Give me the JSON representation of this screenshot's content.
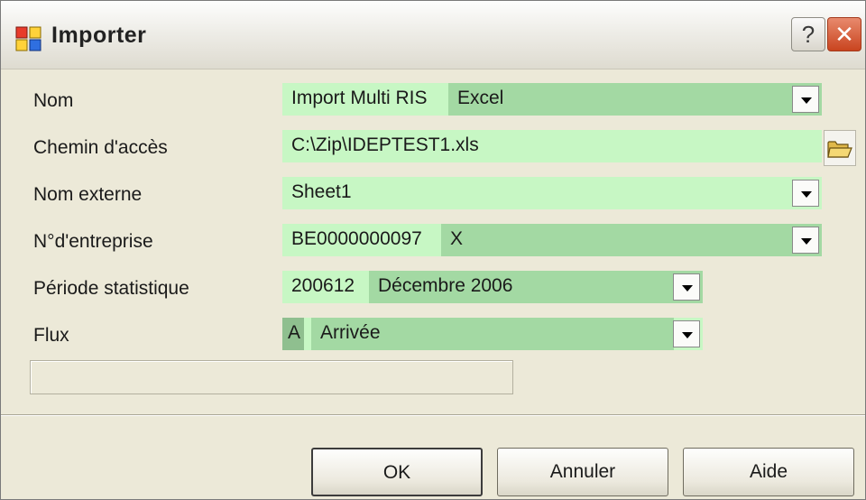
{
  "window": {
    "title": "Importer",
    "help_label": "?",
    "close_label": "✕"
  },
  "fields": {
    "nom": {
      "label": "Nom",
      "code": "Import Multi RIS",
      "value": "Excel"
    },
    "chemin": {
      "label": "Chemin d'accès",
      "value": "C:\\Zip\\IDEPTEST1.xls"
    },
    "nom_externe": {
      "label": "Nom externe",
      "value": "Sheet1"
    },
    "entreprise": {
      "label": "N°d'entreprise",
      "code": "BE0000000097",
      "value": "X"
    },
    "periode": {
      "label": "Période statistique",
      "code": "200612",
      "value": "Décembre 2006"
    },
    "flux": {
      "label": "Flux",
      "code": "A",
      "value": "Arrivée"
    }
  },
  "buttons": {
    "ok": "OK",
    "cancel": "Annuler",
    "help": "Aide"
  },
  "icons": {
    "app": "import-app-icon",
    "folder": "folder-open-icon",
    "dropdown": "chevron-down-icon"
  },
  "colors": {
    "field_bg": "#c7f7c4",
    "field_selected_bg": "#a3d9a3",
    "close_red": "#c9441f"
  }
}
